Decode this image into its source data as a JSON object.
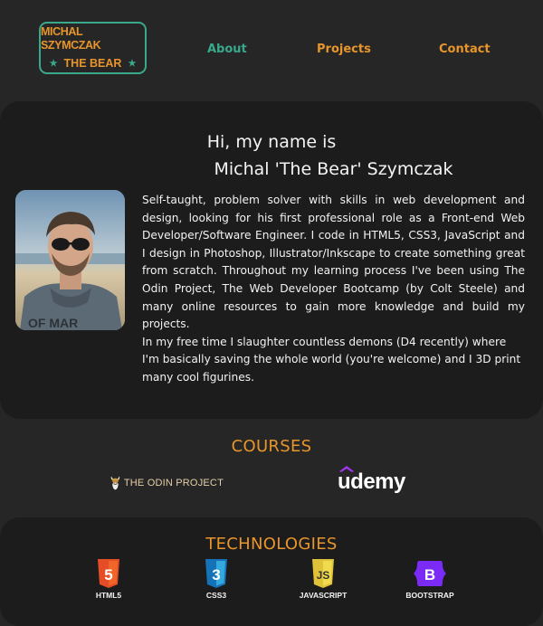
{
  "header": {
    "logo_line1": "MICHAL SZYMCZAK",
    "logo_line2": "THE BEAR",
    "nav": {
      "about": "About",
      "projects": "Projects",
      "contact": "Contact"
    }
  },
  "about": {
    "greeting_line1": "Hi, my name is",
    "greeting_line2": "Michal 'The Bear' Szymczak",
    "bio_paragraph1": "Self-taught, problem solver with skills in web development and design, looking for his first professional role as a Front-end Web Developer/Software Engineer. I code in HTML5, CSS3, JavaScript and I design in Photoshop, Illustrator/Inkscape to create something great from scratch. Throughout my learning process I've been using The Odin Project, The Web Developer Bootcamp (by Colt Steele) and many online resources to gain more knowledge and build my projects.",
    "bio_paragraph2": "In my free time I slaughter countless demons (D4 recently) where I'm basically saving the whole world (you're welcome) and I 3D print many cool figurines."
  },
  "courses": {
    "title": "COURSES",
    "odin_label": "THE ODIN PROJECT",
    "udemy_label": "udemy"
  },
  "technologies": {
    "title": "TECHNOLOGIES",
    "items": [
      {
        "label": "HTML5",
        "glyph": "5",
        "color": "#e44d26"
      },
      {
        "label": "CSS3",
        "glyph": "3",
        "color": "#1572b6"
      },
      {
        "label": "JAVASCRIPT",
        "glyph": "JS",
        "color": "#f0db4f"
      },
      {
        "label": "BOOTSTRAP",
        "glyph": "B",
        "color": "#7a2bf5"
      }
    ]
  },
  "colors": {
    "accent_green": "#3aa98b",
    "accent_orange": "#e8952b",
    "background": "#262626",
    "card": "#1c1c1c"
  }
}
